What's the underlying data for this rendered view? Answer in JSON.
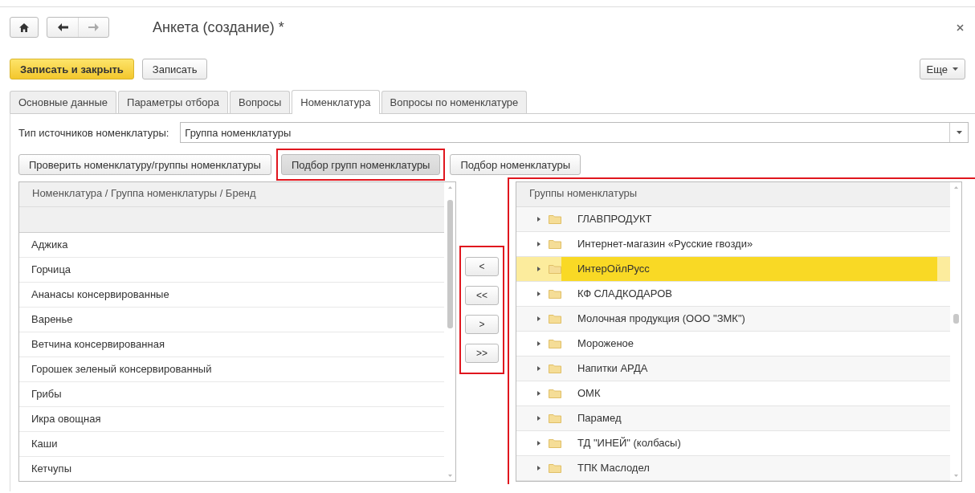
{
  "window": {
    "title": "Анкета (создание) *"
  },
  "toolbar": {
    "buttons": [
      {
        "label": "Записать и закрыть",
        "kind": "primary"
      },
      {
        "label": "Записать",
        "kind": "normal"
      }
    ],
    "more": "Еще"
  },
  "tabs": [
    {
      "label": "Основные данные",
      "selected": false
    },
    {
      "label": "Параметры отбора",
      "selected": false
    },
    {
      "label": "Вопросы",
      "selected": false
    },
    {
      "label": "Номенклатура",
      "selected": true
    },
    {
      "label": "Вопросы по номенклатуре",
      "selected": false
    }
  ],
  "source_type": {
    "label": "Тип источников номенклатуры:",
    "value": "Группа номенклатуры"
  },
  "actions": [
    {
      "label": "Проверить номенклатуру/группы номенклатуры",
      "highlighted": false
    },
    {
      "label": "Подбор групп номенклатуры",
      "highlighted": true
    },
    {
      "label": "Подбор номенклатуры",
      "highlighted": false
    }
  ],
  "left_list": {
    "header": "Номенклатура / Группа номенклатуры / Бренд",
    "rows": [
      "Аджика",
      "Горчица",
      "Ананасы консервированные",
      "Варенье",
      "Ветчина консервированная",
      "Горошек зеленый консервированный",
      "Грибы",
      "Икра овощная",
      "Каши",
      "Кетчупы"
    ]
  },
  "move_buttons": {
    "highlighted": true,
    "buttons": [
      "<",
      "<<",
      ">",
      ">>"
    ]
  },
  "right_list": {
    "header": "Группы номенклатуры",
    "highlighted": true,
    "rows": [
      {
        "label": "ГЛАВПРОДУКТ",
        "selected": false
      },
      {
        "label": "Интернет-магазин «Русские гвозди»",
        "selected": false
      },
      {
        "label": "ИнтерОйлРусс",
        "selected": true
      },
      {
        "label": "КФ СЛАДКОДАРОВ",
        "selected": false
      },
      {
        "label": "Молочная продукция (ООО \"ЗМК\")",
        "selected": false
      },
      {
        "label": "Мороженое",
        "selected": false
      },
      {
        "label": "Напитки АРДА",
        "selected": false
      },
      {
        "label": "ОМК",
        "selected": false
      },
      {
        "label": "Парамед",
        "selected": false
      },
      {
        "label": "ТД \"ИНЕЙ\" (колбасы)",
        "selected": false
      },
      {
        "label": "ТПК Маслодел",
        "selected": false
      }
    ]
  }
}
